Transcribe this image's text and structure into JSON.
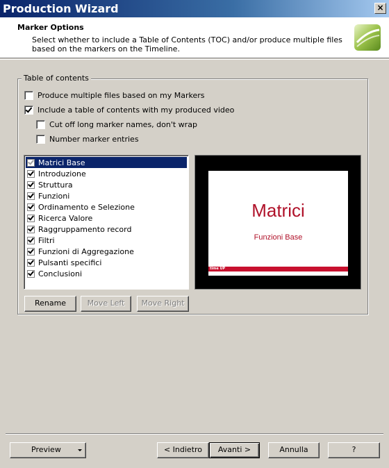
{
  "window": {
    "title": "Production Wizard",
    "close_label": "×"
  },
  "header": {
    "title": "Marker Options",
    "description": "Select whether to include a Table of Contents (TOC) and/or produce multiple files based on the markers on the Timeline."
  },
  "toc": {
    "legend": "Table of contents",
    "options": [
      {
        "label": "Produce multiple files based on my Markers",
        "checked": false
      },
      {
        "label": "Include a table of contents with my produced video",
        "checked": true
      },
      {
        "label": "Cut off long marker names, don't wrap",
        "checked": false
      },
      {
        "label": "Number marker entries",
        "checked": false
      }
    ]
  },
  "markers": [
    {
      "label": "Matrici Base",
      "checked": true,
      "selected": true,
      "disabled": true
    },
    {
      "label": "Introduzione",
      "checked": true
    },
    {
      "label": "Struttura",
      "checked": true
    },
    {
      "label": "Funzioni",
      "checked": true
    },
    {
      "label": "Ordinamento e Selezione",
      "checked": true
    },
    {
      "label": "Ricerca Valore",
      "checked": true
    },
    {
      "label": "Raggruppamento record",
      "checked": true
    },
    {
      "label": "Filtri",
      "checked": true
    },
    {
      "label": "Funzioni di Aggregazione",
      "checked": true
    },
    {
      "label": "Pulsanti specifici",
      "checked": true
    },
    {
      "label": "Conclusioni",
      "checked": true
    }
  ],
  "preview": {
    "slide_title": "Matrici",
    "slide_subtitle": "Funzioni Base",
    "brand": "time UP"
  },
  "list_buttons": {
    "rename": "Rename",
    "move_left": "Move Left",
    "move_right": "Move Right"
  },
  "footer": {
    "preview": "Preview",
    "back": "< Indietro",
    "next": "Avanti >",
    "cancel": "Annulla",
    "help": "?"
  },
  "colors": {
    "title_gradient_start": "#0a246a",
    "slide_accent": "#c8102e",
    "selection": "#0a246a"
  }
}
